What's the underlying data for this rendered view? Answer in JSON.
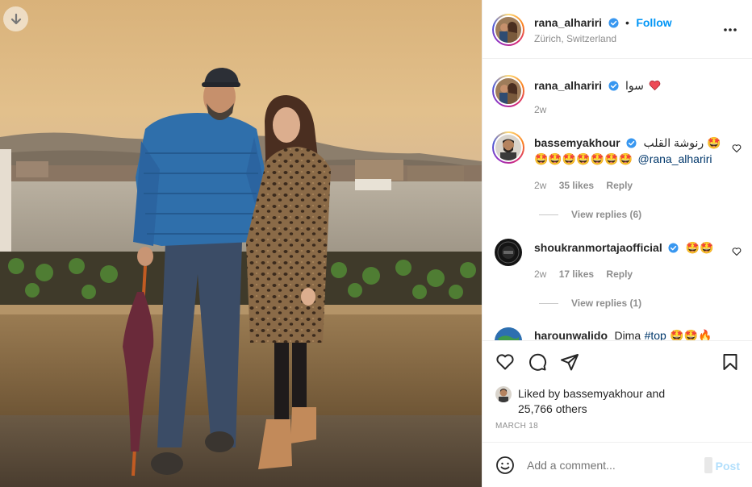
{
  "post": {
    "author": "rana_alhariri",
    "follow_label": "Follow",
    "separator": "•",
    "location": "Zürich, Switzerland"
  },
  "caption": {
    "user": "rana_alhariri",
    "text": "سوا",
    "time": "2w"
  },
  "comments": [
    {
      "user": "bassemyakhour",
      "text_line1": "رنوشة القلب 🤩",
      "text_line2": "🤩🤩🤩🤩🤩🤩🤩",
      "mention": "@rana_alhariri",
      "time": "2w",
      "likes": "35 likes",
      "reply": "Reply",
      "view_replies": "View replies (6)"
    },
    {
      "user": "shoukranmortajaofficial",
      "text": "🤩🤩",
      "time": "2w",
      "likes": "17 likes",
      "reply": "Reply",
      "view_replies": "View replies (1)"
    },
    {
      "user": "harounwalido",
      "text": "Dima",
      "hashtag": "#top",
      "emojis": "🤩🤩🔥"
    }
  ],
  "liked_by": {
    "prefix": "Liked by",
    "user": "bassemyakhour",
    "and": "and",
    "count": "25,766 others"
  },
  "date": "MARCH 18",
  "add_comment": {
    "placeholder": "Add a comment...",
    "post_label": "Post"
  },
  "icons": {
    "download": "arrow-down-icon",
    "more": "more-horizontal-icon",
    "like": "heart-icon",
    "comment": "comment-icon",
    "share": "paper-plane-icon",
    "save": "bookmark-icon",
    "emoji": "smiley-icon",
    "verified": "verified-badge-icon"
  },
  "colors": {
    "accent": "#0095f6",
    "verified": "#3897f0",
    "heart_red": "#ed4956",
    "post_disabled": "#b2dffc"
  }
}
